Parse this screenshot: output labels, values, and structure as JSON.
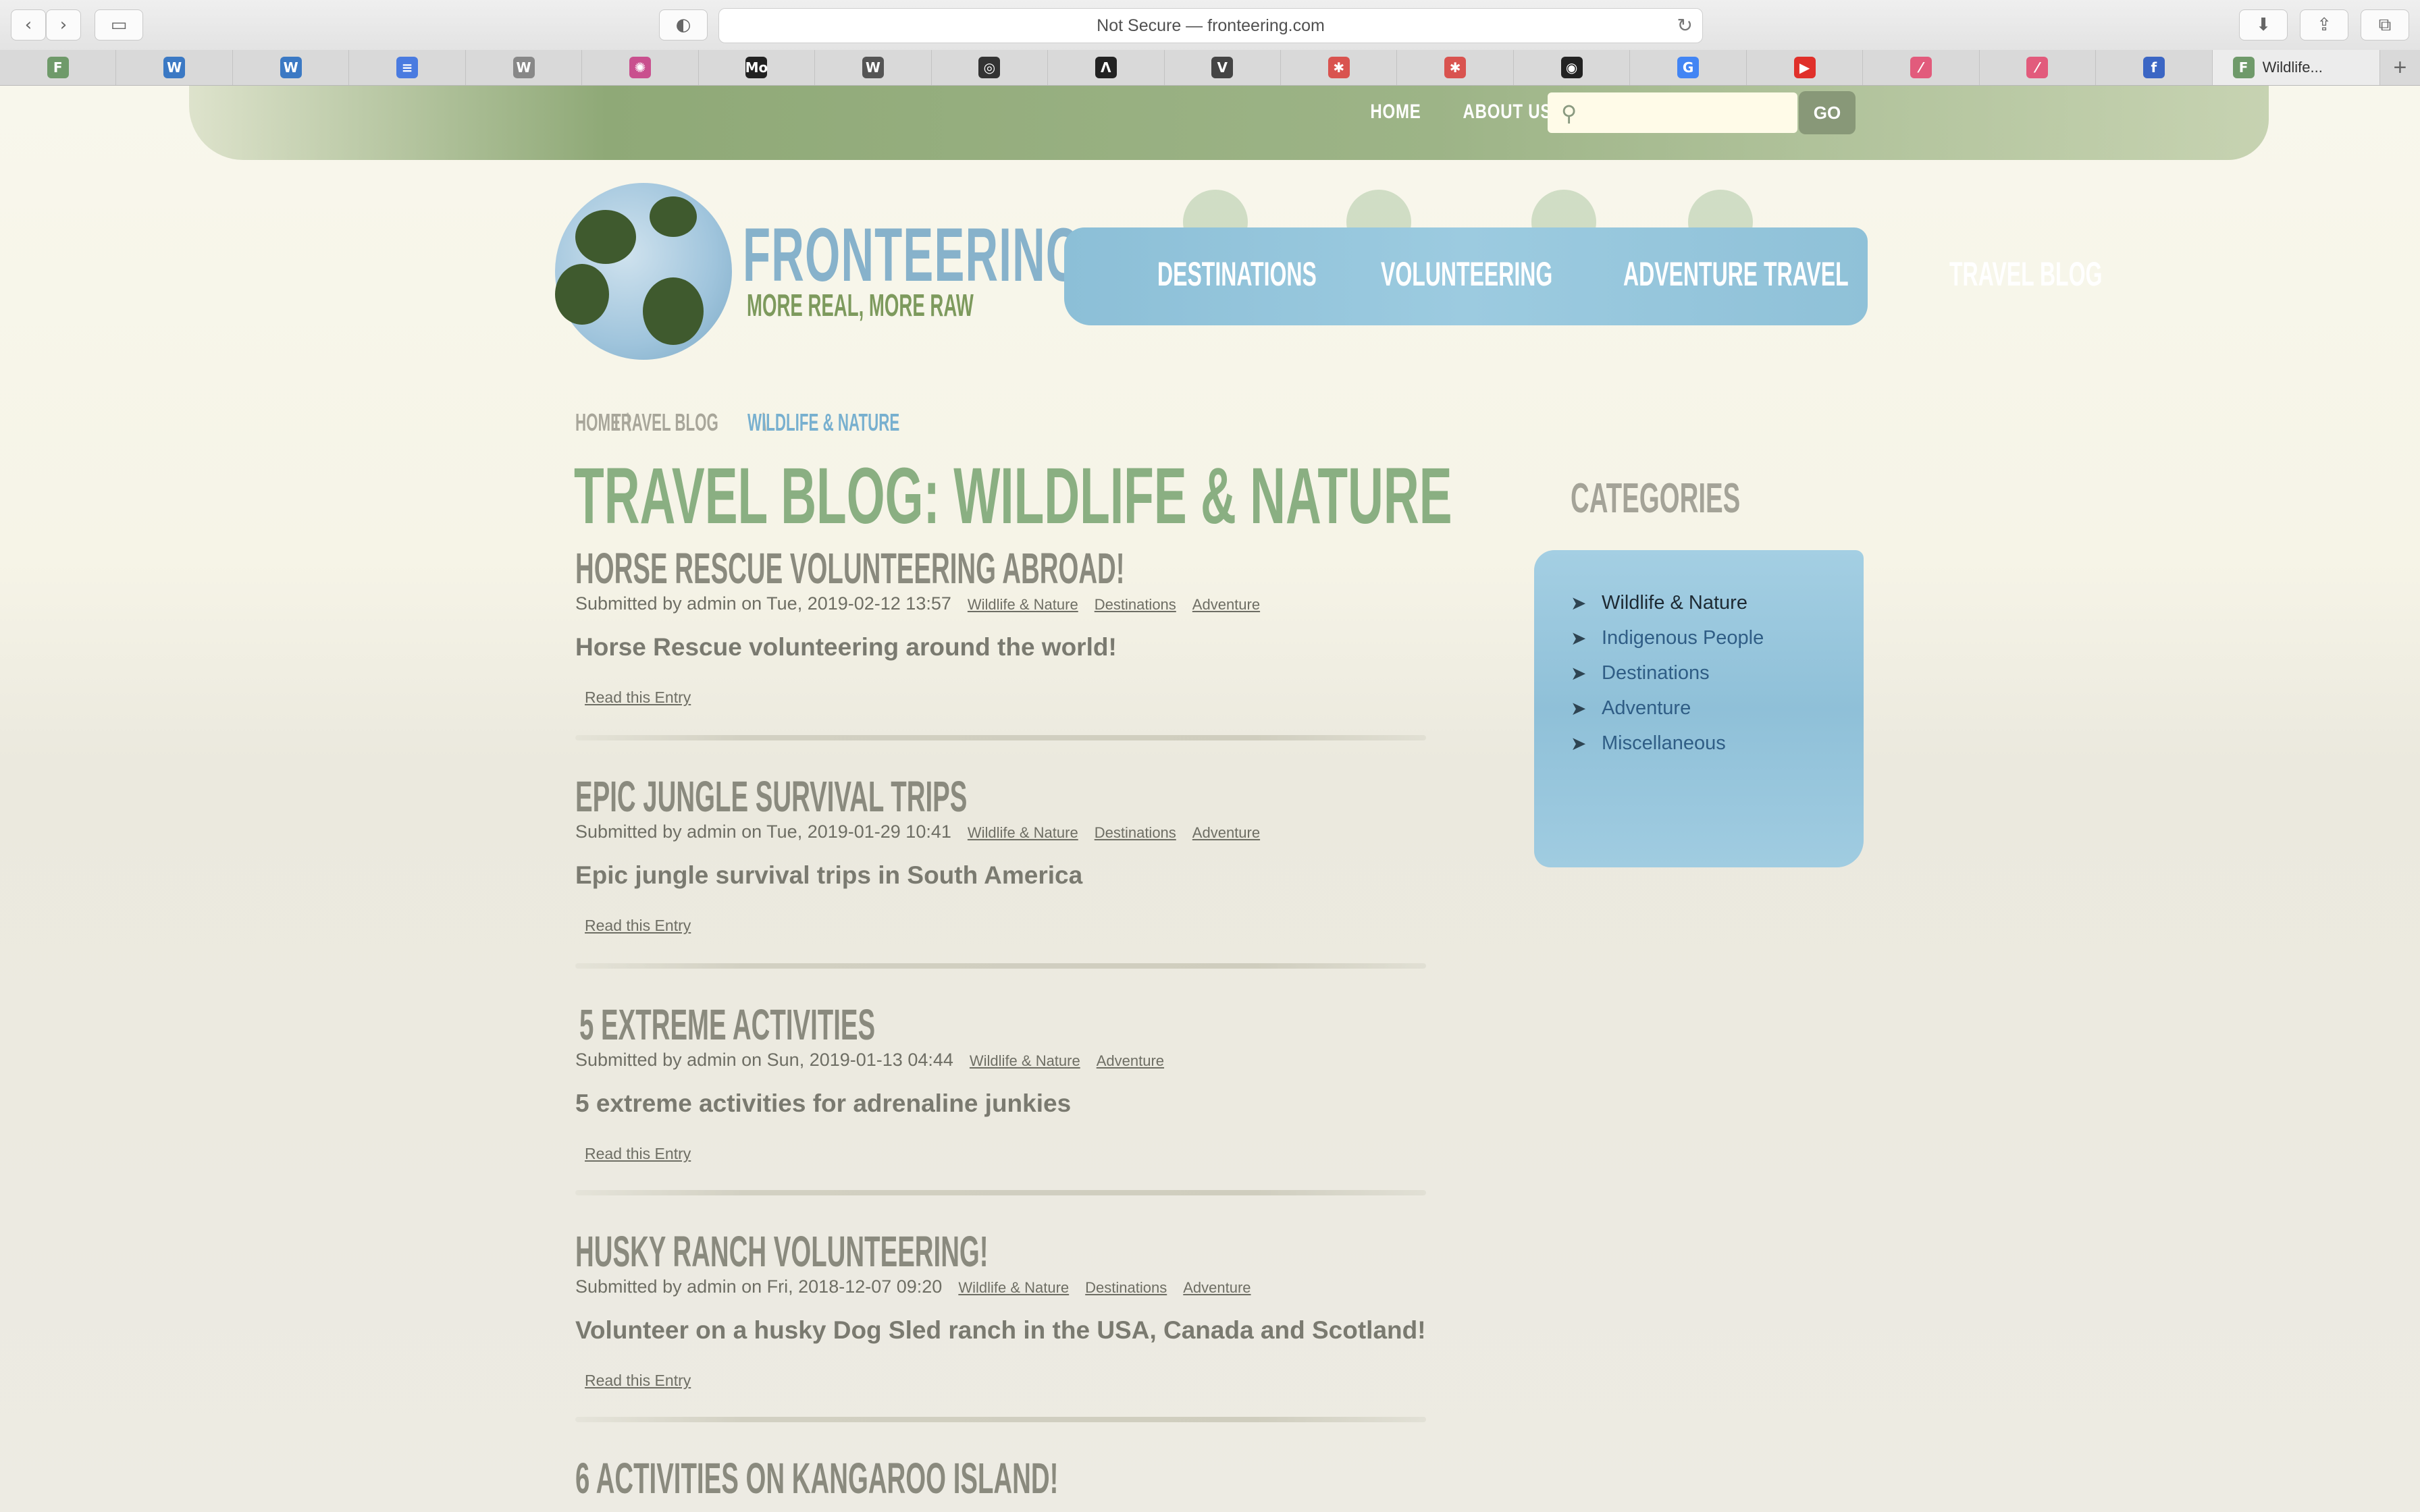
{
  "browser": {
    "url_text": "Not Secure — fronteering.com",
    "active_tab_label": "Wildlife...",
    "favorites": [
      {
        "icon": "fronteering-favicon",
        "glyph": "F",
        "color": "#6f9a6a"
      },
      {
        "icon": "wordpress-icon",
        "glyph": "W",
        "color": "#3b79c4"
      },
      {
        "icon": "wordpress-icon",
        "glyph": "W",
        "color": "#3b79c4"
      },
      {
        "icon": "google-docs-icon",
        "glyph": "≡",
        "color": "#4a7be0"
      },
      {
        "icon": "w-icon",
        "glyph": "W",
        "color": "#888888"
      },
      {
        "icon": "color-wheel-icon",
        "glyph": "✺",
        "color": "#c9508e"
      },
      {
        "icon": "mo-icon",
        "glyph": "Mo",
        "color": "#222222"
      },
      {
        "icon": "wikipedia-icon",
        "glyph": "W",
        "color": "#555555"
      },
      {
        "icon": "instagram-icon",
        "glyph": "◎",
        "color": "#333333"
      },
      {
        "icon": "lambda-icon",
        "glyph": "Λ",
        "color": "#222222"
      },
      {
        "icon": "v-icon",
        "glyph": "V",
        "color": "#444444"
      },
      {
        "icon": "red-wheel-icon",
        "glyph": "✱",
        "color": "#d9534f"
      },
      {
        "icon": "red-wheel-icon",
        "glyph": "✱",
        "color": "#d9534f"
      },
      {
        "icon": "github-icon",
        "glyph": "◉",
        "color": "#222222"
      },
      {
        "icon": "google-icon",
        "glyph": "G",
        "color": "#4285f4"
      },
      {
        "icon": "youtube-icon",
        "glyph": "▶",
        "color": "#e0302a"
      },
      {
        "icon": "pink-app-icon",
        "glyph": "⁄",
        "color": "#e25b7c"
      },
      {
        "icon": "pink-app-icon",
        "glyph": "⁄",
        "color": "#e25b7c"
      },
      {
        "icon": "facebook-icon",
        "glyph": "f",
        "color": "#3b66c4"
      }
    ]
  },
  "site": {
    "top_nav": [
      "HOME",
      "ABOUT US"
    ],
    "search_button": "GO",
    "logo_title": "FRONTEERING",
    "logo_tagline": "MORE REAL, MORE RAW",
    "main_nav": [
      "DESTINATIONS",
      "VOLUNTEERING",
      "ADVENTURE TRAVEL",
      "TRAVEL BLOG"
    ]
  },
  "breadcrumb": {
    "home": "HOME",
    "sep1": "\\",
    "parent": "TRAVEL BLOG",
    "sep2": "\\",
    "current": "WILDLIFE & NATURE"
  },
  "page_title": "TRAVEL BLOG: WILDLIFE & NATURE",
  "entries": [
    {
      "title": "HORSE RESCUE VOLUNTEERING ABROAD!",
      "meta": "Submitted by admin on Tue, 2019-02-12 13:57",
      "tags": [
        "Wildlife & Nature",
        "Destinations",
        "Adventure"
      ],
      "summary": "Horse Rescue volunteering around the world!",
      "read_link": "Read this Entry"
    },
    {
      "title": "EPIC JUNGLE SURVIVAL TRIPS",
      "meta": "Submitted by admin on Tue, 2019-01-29 10:41",
      "tags": [
        "Wildlife & Nature",
        "Destinations",
        "Adventure"
      ],
      "summary": "Epic jungle survival trips in South America",
      "read_link": "Read this Entry"
    },
    {
      "title": "5 EXTREME ACTIVITIES",
      "meta": "Submitted by admin on Sun, 2019-01-13 04:44",
      "tags": [
        "Wildlife & Nature",
        "Adventure"
      ],
      "summary": "5 extreme activities for adrenaline junkies",
      "read_link": "Read this Entry"
    },
    {
      "title": "HUSKY RANCH VOLUNTEERING!",
      "meta": "Submitted by admin on Fri, 2018-12-07 09:20",
      "tags": [
        "Wildlife & Nature",
        "Destinations",
        "Adventure"
      ],
      "summary": "Volunteer on a husky Dog Sled ranch in the USA, Canada and Scotland!",
      "read_link": "Read this Entry"
    },
    {
      "title": "6 ACTIVITIES ON KANGAROO ISLAND!"
    }
  ],
  "categories": {
    "title": "CATEGORIES",
    "items": [
      "Wildlife & Nature",
      "Indigenous People",
      "Destinations",
      "Adventure",
      "Miscellaneous"
    ],
    "active": "Wildlife & Nature"
  }
}
